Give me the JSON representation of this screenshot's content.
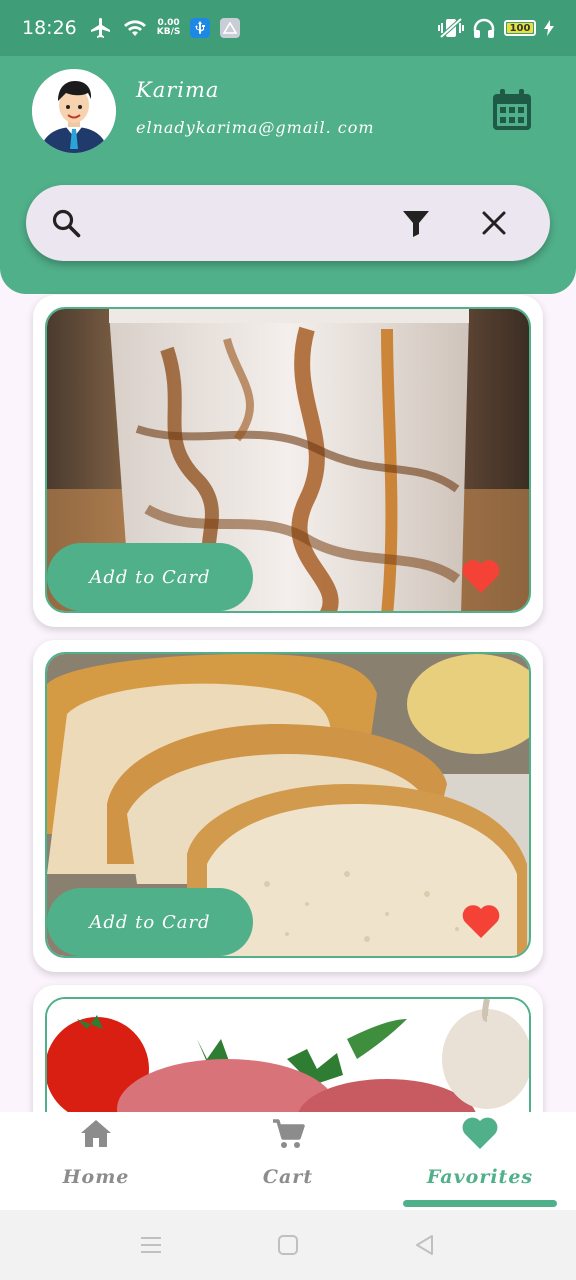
{
  "status_bar": {
    "time": "18:26",
    "speed_value": "0.00",
    "speed_unit": "KB/S",
    "battery": "100",
    "icons": [
      "airplane-icon",
      "wifi-icon",
      "usb-icon",
      "drive-icon",
      "vibrate-icon",
      "headphones-icon",
      "charging-icon"
    ]
  },
  "header": {
    "user_name": "Karima",
    "user_email": "elnadykarima@gmail. com",
    "calendar_icon": "calendar-icon"
  },
  "search": {
    "value": "",
    "placeholder": "",
    "icons": [
      "search-icon",
      "filter-icon",
      "close-icon"
    ]
  },
  "products": [
    {
      "image": "iced caramel latte",
      "button_label": "Add to Card",
      "favorite": true
    },
    {
      "image": "sliced white bread",
      "button_label": "Add to Card",
      "favorite": true
    },
    {
      "image": "meat with tomato and garlic",
      "button_label": "",
      "favorite": true
    }
  ],
  "bottom_nav": {
    "items": [
      {
        "label": "Home",
        "icon": "home-icon",
        "active": false
      },
      {
        "label": "Cart",
        "icon": "cart-icon",
        "active": false
      },
      {
        "label": "Favorites",
        "icon": "heart-icon",
        "active": true
      }
    ]
  },
  "colors": {
    "primary": "#50b08a",
    "status_bar": "#3f9e78",
    "heart": "#f44336",
    "inactive": "#8c8c8c",
    "search_bg": "#ebe6f0"
  }
}
